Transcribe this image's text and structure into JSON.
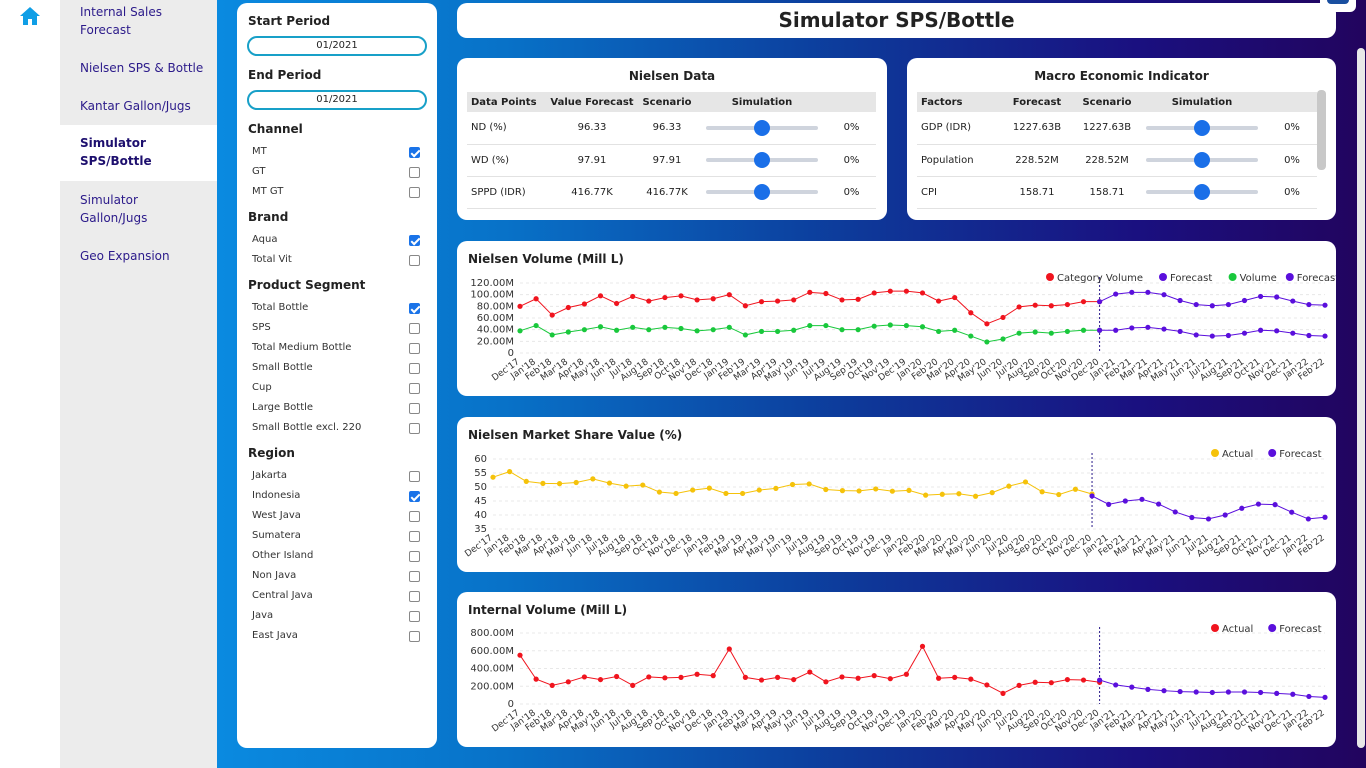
{
  "nav": {
    "items": [
      {
        "label_1": "Internal Sales",
        "label_2": "Forecast"
      },
      {
        "label_1": "Nielsen SPS & Bottle"
      },
      {
        "label_1": "Kantar Gallon/Jugs"
      },
      {
        "label_1": "Simulator",
        "label_2": "SPS/Bottle"
      },
      {
        "label_1": "Simulator",
        "label_2": "Gallon/Jugs"
      },
      {
        "label_1": "Geo Expansion"
      }
    ]
  },
  "filters": {
    "start_label": "Start Period",
    "start_value": "01/2021",
    "end_label": "End Period",
    "end_value": "01/2021",
    "channel_label": "Channel",
    "channel": [
      {
        "label": "MT",
        "checked": true
      },
      {
        "label": "GT",
        "checked": false
      },
      {
        "label": "MT GT",
        "checked": false
      }
    ],
    "brand_label": "Brand",
    "brand": [
      {
        "label": "Aqua",
        "checked": true
      },
      {
        "label": "Total Vit",
        "checked": false
      }
    ],
    "segment_label": "Product Segment",
    "segment": [
      {
        "label": "Total Bottle",
        "checked": true
      },
      {
        "label": "SPS",
        "checked": false
      },
      {
        "label": "Total Medium Bottle",
        "checked": false
      },
      {
        "label": "Small Bottle",
        "checked": false
      },
      {
        "label": "Cup",
        "checked": false
      },
      {
        "label": "Large Bottle",
        "checked": false
      },
      {
        "label": "Small Bottle excl. 220",
        "checked": false
      }
    ],
    "region_label": "Region",
    "region": [
      {
        "label": "Jakarta",
        "checked": false
      },
      {
        "label": "Indonesia",
        "checked": true
      },
      {
        "label": "West Java",
        "checked": false
      },
      {
        "label": "Sumatera",
        "checked": false
      },
      {
        "label": "Other Island",
        "checked": false
      },
      {
        "label": "Non Java",
        "checked": false
      },
      {
        "label": "Central Java",
        "checked": false
      },
      {
        "label": "Java",
        "checked": false
      },
      {
        "label": "East Java",
        "checked": false
      }
    ]
  },
  "page_title": "Simulator SPS/Bottle",
  "nielsen": {
    "title": "Nielsen Data",
    "headers": [
      "Data Points",
      "Value Forecast",
      "Scenario",
      "Simulation"
    ],
    "rows": [
      {
        "name": "ND (%)",
        "forecast": "96.33",
        "scenario": "96.33",
        "sim": 0.5,
        "pct": "0%"
      },
      {
        "name": "WD (%)",
        "forecast": "97.91",
        "scenario": "97.91",
        "sim": 0.5,
        "pct": "0%"
      },
      {
        "name": "SPPD (IDR)",
        "forecast": "416.77K",
        "scenario": "416.77K",
        "sim": 0.5,
        "pct": "0%"
      }
    ]
  },
  "macro": {
    "title": "Macro Economic Indicator",
    "headers": [
      "Factors",
      "Forecast",
      "Scenario",
      "Simulation"
    ],
    "rows": [
      {
        "name": "GDP (IDR)",
        "forecast": "1227.63B",
        "scenario": "1227.63B",
        "sim": 0.5,
        "pct": "0%"
      },
      {
        "name": "Population",
        "forecast": "228.52M",
        "scenario": "228.52M",
        "sim": 0.5,
        "pct": "0%"
      },
      {
        "name": "CPI",
        "forecast": "158.71",
        "scenario": "158.71",
        "sim": 0.5,
        "pct": "0%"
      }
    ]
  },
  "colors": {
    "red": "#f0141e",
    "green": "#19c83c",
    "purple": "#5a0fdc",
    "yellow": "#f5c20a"
  },
  "chart_data": [
    {
      "type": "line",
      "title": "Nielsen Volume (Mill L)",
      "x": [
        "Dec'17",
        "Jan'18",
        "Feb'18",
        "Mar'18",
        "Apr'18",
        "May'18",
        "Jun'18",
        "Jul'18",
        "Aug'18",
        "Sep'18",
        "Oct'18",
        "Nov'18",
        "Dec'18",
        "Jan'19",
        "Feb'19",
        "Mar'19",
        "Apr'19",
        "May'19",
        "Jun'19",
        "Jul'19",
        "Aug'19",
        "Sep'19",
        "Oct'19",
        "Nov'19",
        "Dec'19",
        "Jan'20",
        "Feb'20",
        "Mar'20",
        "Apr'20",
        "May'20",
        "Jun'20",
        "Jul'20",
        "Aug'20",
        "Sep'20",
        "Oct'20",
        "Nov'20",
        "Dec'20",
        "Jan'21",
        "Feb'21",
        "Mar'21",
        "Apr'21",
        "May'21",
        "Jun'21",
        "Jul'21",
        "Aug'21",
        "Sep'21",
        "Oct'21",
        "Nov'21",
        "Dec'21",
        "Jan'22",
        "Feb'22"
      ],
      "yticks": [
        "120.00M",
        "100.00M",
        "80.00M",
        "60.00M",
        "40.00M",
        "20.00M",
        "0"
      ],
      "ylim": [
        0,
        120
      ],
      "split_index": 36,
      "legend": [
        "Category Volume",
        "Forecast",
        "Volume",
        "Forecast"
      ],
      "series": [
        {
          "name": "Category Volume",
          "color": "#f0141e",
          "from": 0,
          "values": [
            80,
            93,
            65,
            78,
            84,
            98,
            85,
            97,
            89,
            95,
            98,
            91,
            93,
            100,
            81,
            88,
            89,
            91,
            104,
            102,
            91,
            92,
            103,
            106,
            106,
            103,
            89,
            95,
            69,
            50,
            61,
            79,
            82,
            81,
            83,
            88,
            88
          ]
        },
        {
          "name": "Forecast",
          "color": "#5a0fdc",
          "from": 36,
          "values": [
            88,
            101,
            104,
            104,
            100,
            90,
            83,
            81,
            83,
            90,
            97,
            96,
            89,
            83,
            82
          ]
        },
        {
          "name": "Volume",
          "color": "#19c83c",
          "from": 0,
          "values": [
            38,
            47,
            31,
            36,
            40,
            45,
            39,
            44,
            40,
            44,
            42,
            38,
            40,
            44,
            31,
            37,
            37,
            39,
            47,
            47,
            40,
            40,
            46,
            48,
            47,
            45,
            37,
            39,
            29,
            19,
            24,
            34,
            36,
            34,
            37,
            39,
            39
          ]
        },
        {
          "name": "Forecast",
          "color": "#5a0fdc",
          "from": 36,
          "values": [
            39,
            39,
            43,
            44,
            41,
            37,
            31,
            29,
            30,
            34,
            39,
            38,
            34,
            30,
            29
          ]
        }
      ]
    },
    {
      "type": "line",
      "title": "Nielsen Market Share Value (%)",
      "x": [
        "Dec'17",
        "Jan'18",
        "Feb'18",
        "Mar'18",
        "Apr'18",
        "May'18",
        "Jun'18",
        "Jul'18",
        "Aug'18",
        "Sep'18",
        "Oct'18",
        "Nov'18",
        "Dec'18",
        "Jan'19",
        "Feb'19",
        "Mar'19",
        "Apr'19",
        "May'19",
        "Jun'19",
        "Jul'19",
        "Aug'19",
        "Sep'19",
        "Oct'19",
        "Nov'19",
        "Dec'19",
        "Jan'20",
        "Feb'20",
        "Mar'20",
        "Apr'20",
        "May'20",
        "Jun'20",
        "Jul'20",
        "Aug'20",
        "Sep'20",
        "Oct'20",
        "Nov'20",
        "Dec'20",
        "Jan'21",
        "Feb'21",
        "Mar'21",
        "Apr'21",
        "May'21",
        "Jun'21",
        "Jul'21",
        "Aug'21",
        "Sep'21",
        "Oct'21",
        "Nov'21",
        "Dec'21",
        "Jan'22",
        "Feb'22"
      ],
      "yticks": [
        "60",
        "55",
        "50",
        "45",
        "40",
        "35"
      ],
      "ylim": [
        35,
        60
      ],
      "split_index": 36,
      "legend": [
        "Actual",
        "Forecast"
      ],
      "series": [
        {
          "name": "Actual",
          "color": "#f5c20a",
          "from": 0,
          "values": [
            53.5,
            55.5,
            52,
            51.3,
            51.2,
            51.6,
            52.9,
            51.4,
            50.3,
            50.7,
            48.2,
            47.7,
            48.9,
            49.6,
            47.7,
            47.7,
            48.9,
            49.5,
            50.9,
            51.1,
            49.1,
            48.7,
            48.6,
            49.3,
            48.5,
            48.8,
            47.1,
            47.4,
            47.6,
            46.7,
            48,
            50.3,
            51.8,
            48.3,
            47.3,
            49.2,
            47.5
          ]
        },
        {
          "name": "Forecast",
          "color": "#5a0fdc",
          "from": 36,
          "values": [
            46.8,
            43.8,
            45,
            45.6,
            43.9,
            41.1,
            39.1,
            38.6,
            40,
            42.4,
            43.9,
            43.7,
            41,
            38.6,
            39.2
          ]
        }
      ]
    },
    {
      "type": "line",
      "title": "Internal Volume (Mill L)",
      "x": [
        "Dec'17",
        "Jan'18",
        "Feb'18",
        "Mar'18",
        "Apr'18",
        "May'18",
        "Jun'18",
        "Jul'18",
        "Aug'18",
        "Sep'18",
        "Oct'18",
        "Nov'18",
        "Dec'18",
        "Jan'19",
        "Feb'19",
        "Mar'19",
        "Apr'19",
        "May'19",
        "Jun'19",
        "Jul'19",
        "Aug'19",
        "Sep'19",
        "Oct'19",
        "Nov'19",
        "Dec'19",
        "Jan'20",
        "Feb'20",
        "Mar'20",
        "Apr'20",
        "May'20",
        "Jun'20",
        "Jul'20",
        "Aug'20",
        "Sep'20",
        "Oct'20",
        "Nov'20",
        "Dec'20",
        "Jan'21",
        "Feb'21",
        "Mar'21",
        "Apr'21",
        "May'21",
        "Jun'21",
        "Jul'21",
        "Aug'21",
        "Sep'21",
        "Oct'21",
        "Nov'21",
        "Dec'21",
        "Jan'22",
        "Feb'22"
      ],
      "yticks": [
        "800.00M",
        "600.00M",
        "400.00M",
        "200.00M",
        "0"
      ],
      "ylim": [
        0,
        800
      ],
      "split_index": 36,
      "legend": [
        "Actual",
        "Forecast"
      ],
      "series": [
        {
          "name": "Actual",
          "color": "#f0141e",
          "from": 0,
          "values": [
            550,
            280,
            210,
            250,
            305,
            275,
            310,
            210,
            305,
            295,
            300,
            335,
            320,
            620,
            300,
            270,
            300,
            275,
            360,
            250,
            305,
            290,
            320,
            285,
            335,
            650,
            290,
            300,
            280,
            215,
            120,
            210,
            245,
            240,
            275,
            270,
            245
          ]
        },
        {
          "name": "Forecast",
          "color": "#5a0fdc",
          "from": 36,
          "values": [
            270,
            215,
            190,
            165,
            150,
            140,
            135,
            130,
            135,
            135,
            130,
            120,
            110,
            85,
            75
          ]
        }
      ]
    }
  ]
}
